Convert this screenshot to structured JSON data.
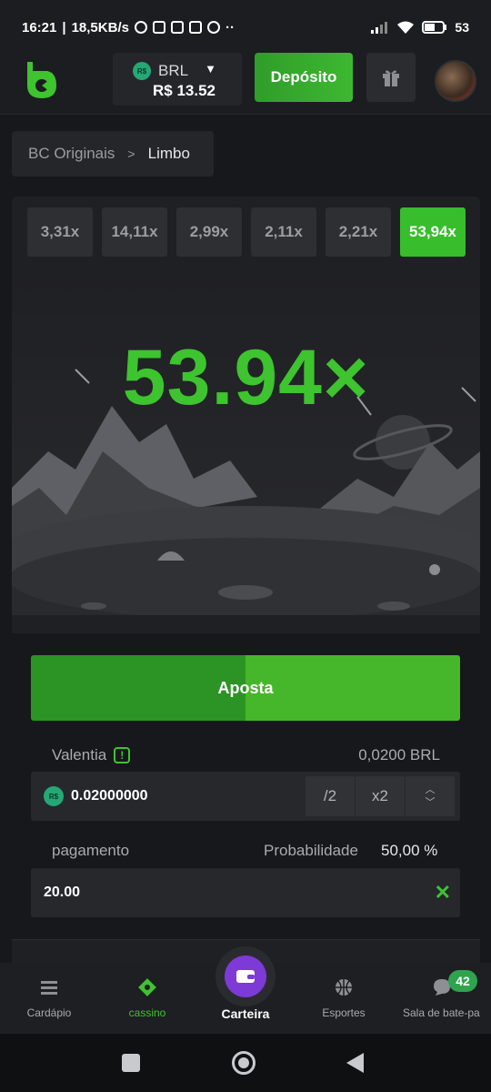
{
  "status": {
    "time": "16:21",
    "network_speed": "18,5KB/s",
    "battery": "53"
  },
  "header": {
    "currency": "BRL",
    "coin_symbol": "R$",
    "balance": "R$ 13.52",
    "deposit_label": "Depósito"
  },
  "breadcrumb": {
    "parent": "BC Originais",
    "current": "Limbo"
  },
  "game": {
    "history": [
      "3,31x",
      "14,11x",
      "2,99x",
      "2,11x",
      "2,21x",
      "53,94x"
    ],
    "multiplier": "53.94×"
  },
  "bet": {
    "button_label": "Aposta",
    "amount_label": "Valentia",
    "amount_brl": "0,0200 BRL",
    "amount_value": "0.02000000",
    "half_label": "/2",
    "double_label": "x2",
    "payout_label": "pagamento",
    "probability_label": "Probabilidade",
    "probability_value": "50,00 %",
    "payout_value": "20.00"
  },
  "bottom_nav": {
    "items": [
      {
        "label": "Cardápio"
      },
      {
        "label": "cassino"
      },
      {
        "label": "Carteira"
      },
      {
        "label": "Esportes"
      },
      {
        "label": "Sala de bate-pa"
      }
    ],
    "chat_badge": "42"
  },
  "colors": {
    "accent_green": "#3dc42f",
    "background": "#17181b",
    "wallet_purple": "#7e3ad6"
  }
}
